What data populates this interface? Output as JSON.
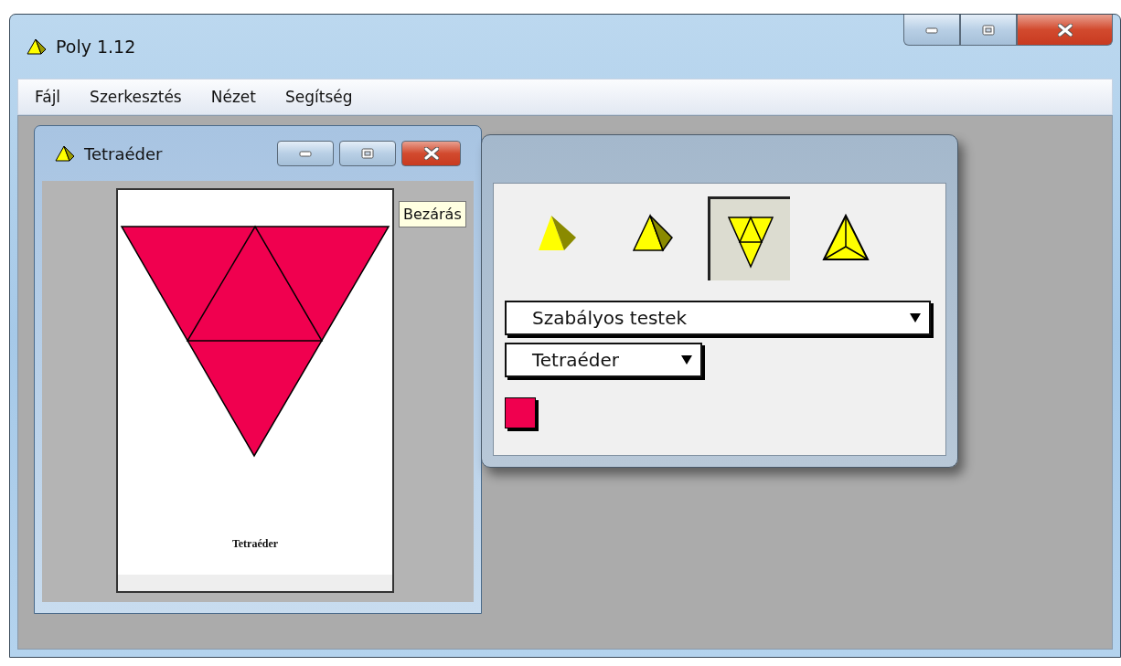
{
  "window": {
    "title": "Poly 1.12"
  },
  "menu": [
    {
      "label": "Fájl"
    },
    {
      "label": "Szerkesztés"
    },
    {
      "label": "Nézet"
    },
    {
      "label": "Segítség"
    }
  ],
  "child_window": {
    "title": "Tetraéder",
    "tooltip": "Bezárás",
    "caption": "Tetraéder"
  },
  "tool_window": {
    "views": [
      {
        "kind": "solid",
        "selected": false
      },
      {
        "kind": "outlined",
        "selected": false
      },
      {
        "kind": "net",
        "selected": true
      },
      {
        "kind": "top",
        "selected": false
      }
    ],
    "family_select": {
      "value": "Szabályos testek"
    },
    "solid_select": {
      "value": "Tetraéder"
    },
    "color_swatch": {
      "color": "#f0004f"
    }
  }
}
